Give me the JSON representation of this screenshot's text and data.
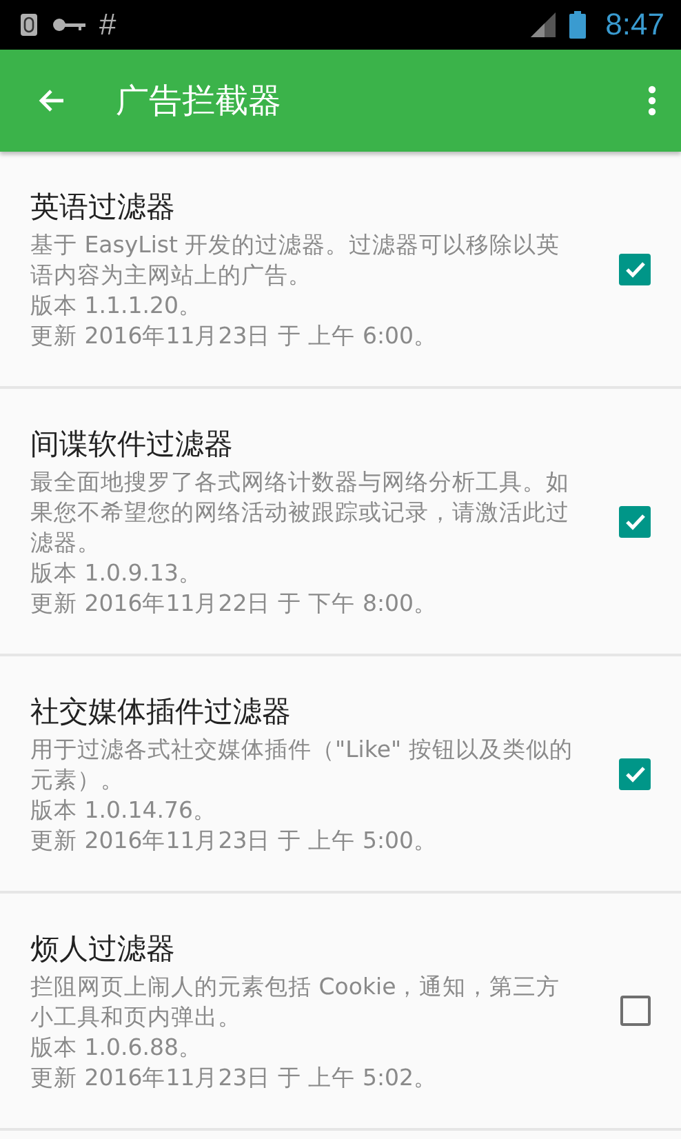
{
  "status_bar": {
    "time": "8:47",
    "left_glyph": "#"
  },
  "app_bar": {
    "title": "广告拦截器"
  },
  "filters": [
    {
      "title": "英语过滤器",
      "description": "基于 EasyList 开发的过滤器。过滤器可以移除以英语内容为主网站上的广告。",
      "version": "版本 1.1.1.20。",
      "updated": "更新 2016年11月23日 于 上午 6:00。",
      "checked": true
    },
    {
      "title": "间谍软件过滤器",
      "description": "最全面地搜罗了各式网络计数器与网络分析工具。如果您不希望您的网络活动被跟踪或记录，请激活此过滤器。",
      "version": "版本 1.0.9.13。",
      "updated": "更新 2016年11月22日 于 下午 8:00。",
      "checked": true
    },
    {
      "title": "社交媒体插件过滤器",
      "description": "用于过滤各式社交媒体插件（\"Like\" 按钮以及类似的元素）。",
      "version": "版本 1.0.14.76。",
      "updated": "更新 2016年11月23日 于 上午 5:00。",
      "checked": true
    },
    {
      "title": "烦人过滤器",
      "description": "拦阻网页上闹人的元素包括 Cookie，通知，第三方小工具和页内弹出。",
      "version": "版本 1.0.6.88。",
      "updated": "更新 2016年11月23日 于 上午 5:02。",
      "checked": false
    }
  ]
}
